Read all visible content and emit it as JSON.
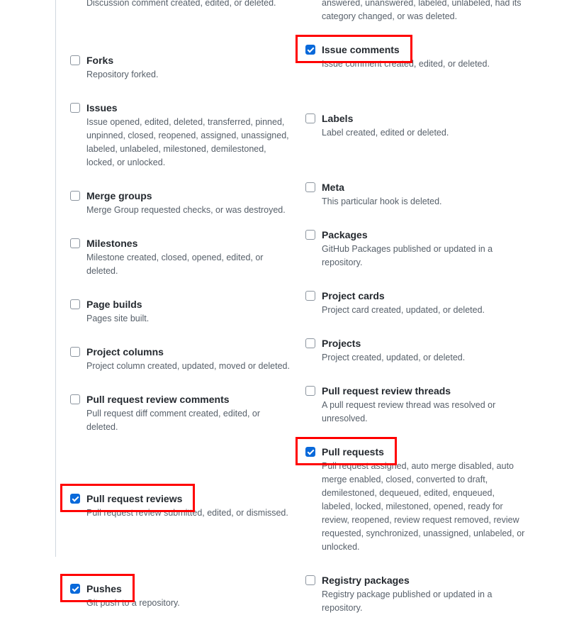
{
  "left_truncated_desc": "Discussion comment created, edited, or deleted.",
  "right_truncated_desc": "answered, unanswered, labeled, unlabeled, had its category changed, or was deleted.",
  "left": [
    {
      "title": "Forks",
      "desc": "Repository forked.",
      "checked": false,
      "hl": false,
      "top_pad": 38
    },
    {
      "title": "Issues",
      "desc": "Issue opened, edited, deleted, transferred, pinned, unpinned, closed, reopened, assigned, unassigned, labeled, unlabeled, milestoned, demilestoned, locked, or unlocked.",
      "checked": false,
      "hl": false,
      "top_pad": 0
    },
    {
      "title": "Merge groups",
      "desc": "Merge Group requested checks, or was destroyed.",
      "checked": false,
      "hl": false,
      "top_pad": 0
    },
    {
      "title": "Milestones",
      "desc": "Milestone created, closed, opened, edited, or deleted.",
      "checked": false,
      "hl": false,
      "top_pad": 0
    },
    {
      "title": "Page builds",
      "desc": "Pages site built.",
      "checked": false,
      "hl": false,
      "top_pad": 0
    },
    {
      "title": "Project columns",
      "desc": "Project column created, updated, moved or deleted.",
      "checked": false,
      "hl": false,
      "top_pad": 0
    },
    {
      "title": "Pull request review comments",
      "desc": "Pull request diff comment created, edited, or deleted.",
      "checked": false,
      "hl": false,
      "top_pad": 0
    },
    {
      "title": "Pull request reviews",
      "desc": "Pull request review submitted, edited, or dismissed.",
      "checked": true,
      "hl": true,
      "top_pad": 58
    },
    {
      "title": "Pushes",
      "desc": "Git push to a repository.",
      "checked": true,
      "hl": true,
      "top_pad": 64
    }
  ],
  "right": [
    {
      "title": "Issue comments",
      "desc": "Issue comment created, edited, or deleted.",
      "checked": true,
      "hl": true,
      "top_pad": 0
    },
    {
      "title": "Labels",
      "desc": "Label created, edited or deleted.",
      "checked": false,
      "hl": false,
      "top_pad": 34
    },
    {
      "title": "Meta",
      "desc": "This particular hook is deleted.",
      "checked": false,
      "hl": false,
      "top_pad": 34
    },
    {
      "title": "Packages",
      "desc": "GitHub Packages published or updated in a repository.",
      "checked": false,
      "hl": false,
      "top_pad": 0
    },
    {
      "title": "Project cards",
      "desc": "Project card created, updated, or deleted.",
      "checked": false,
      "hl": false,
      "top_pad": 0
    },
    {
      "title": "Projects",
      "desc": "Project created, updated, or deleted.",
      "checked": false,
      "hl": false,
      "top_pad": 0
    },
    {
      "title": "Pull request review threads",
      "desc": "A pull request review thread was resolved or unresolved.",
      "checked": false,
      "hl": false,
      "top_pad": 0
    },
    {
      "title": "Pull requests",
      "desc": "Pull request assigned, auto merge disabled, auto merge enabled, closed, converted to draft, demilestoned, dequeued, edited, enqueued, labeled, locked, milestoned, opened, ready for review, reopened, review request removed, review requested, synchronized, unassigned, unlabeled, or unlocked.",
      "checked": true,
      "hl": true,
      "top_pad": 0
    },
    {
      "title": "Registry packages",
      "desc": "Registry package published or updated in a repository.",
      "checked": false,
      "hl": false,
      "top_pad": 0
    }
  ]
}
